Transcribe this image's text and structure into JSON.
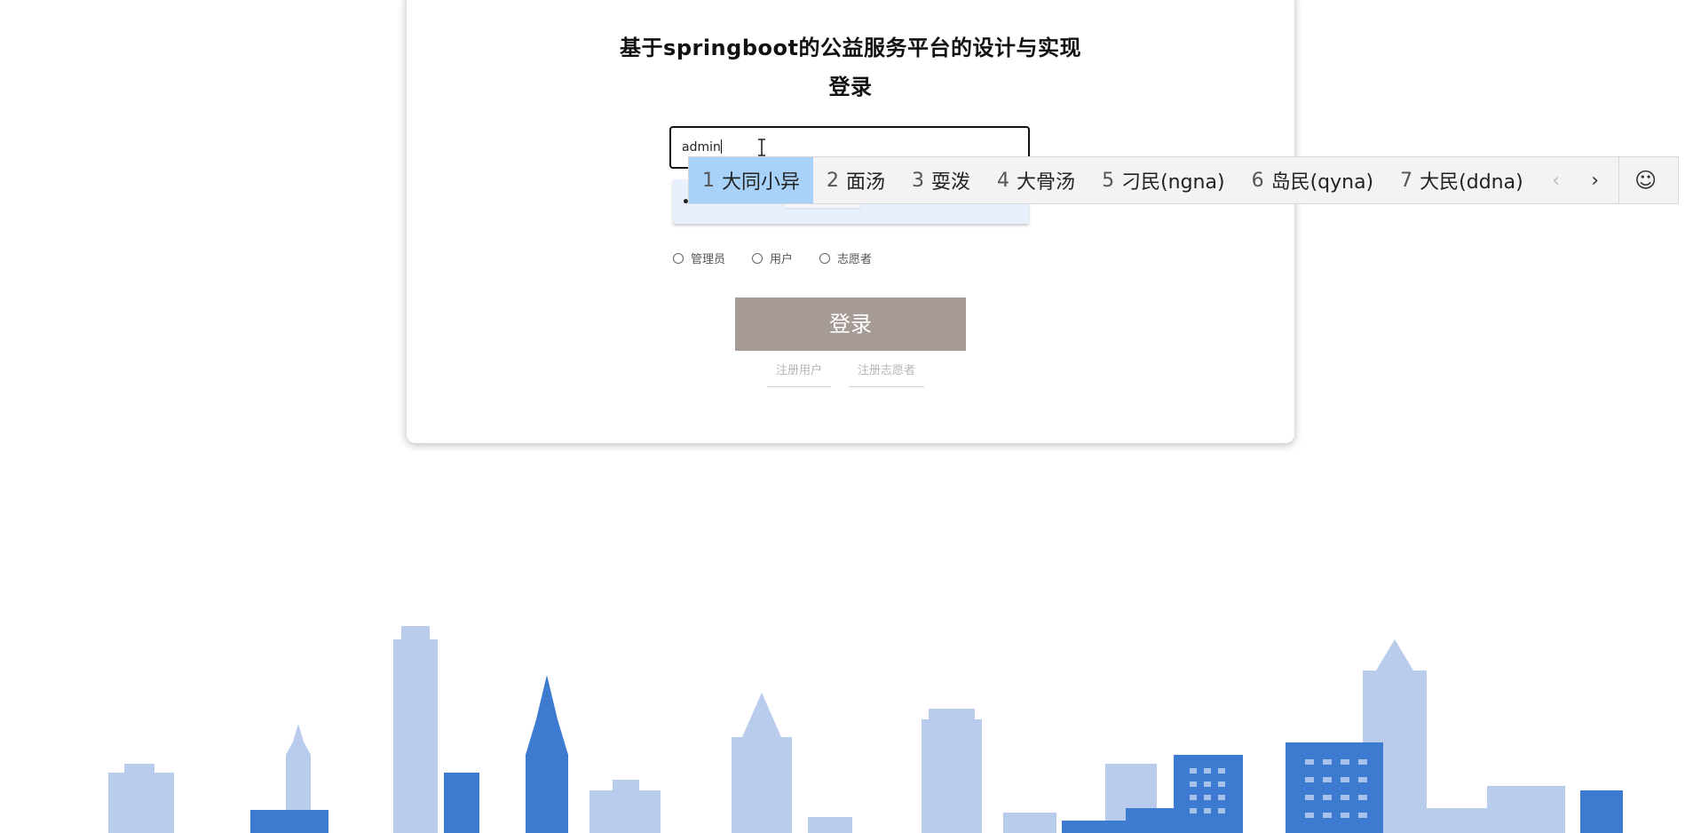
{
  "page": {
    "title": "基于springboot的公益服务平台的设计与实现",
    "subtitle": "登录"
  },
  "form": {
    "username_value": "admin",
    "password_mask": "•••",
    "roles": [
      {
        "label": "管理员",
        "checked": false
      },
      {
        "label": "用户",
        "checked": false
      },
      {
        "label": "志愿者",
        "checked": false
      }
    ],
    "login_label": "登录",
    "links": {
      "register_user": "注册用户",
      "register_volunteer": "注册志愿者"
    }
  },
  "ime": {
    "candidates": [
      {
        "num": "1",
        "text": "大同小异",
        "selected": true
      },
      {
        "num": "2",
        "text": "面汤"
      },
      {
        "num": "3",
        "text": "耍泼"
      },
      {
        "num": "4",
        "text": "大骨汤"
      },
      {
        "num": "5",
        "text": "刁民(ngna)"
      },
      {
        "num": "6",
        "text": "岛民(qyna)"
      },
      {
        "num": "7",
        "text": "大民(ddna)"
      }
    ],
    "prev_glyph": "‹",
    "next_glyph": "›",
    "emoji_glyph": "☺"
  },
  "colors": {
    "login_button": "#a69b95",
    "ime_selected": "#a9d2fb",
    "skyline_dark": "#3d7bd0",
    "skyline_light": "#b9ccec"
  },
  "icons": [
    "text-cursor-icon",
    "chevron-left-icon",
    "chevron-right-icon",
    "emoji-icon"
  ]
}
